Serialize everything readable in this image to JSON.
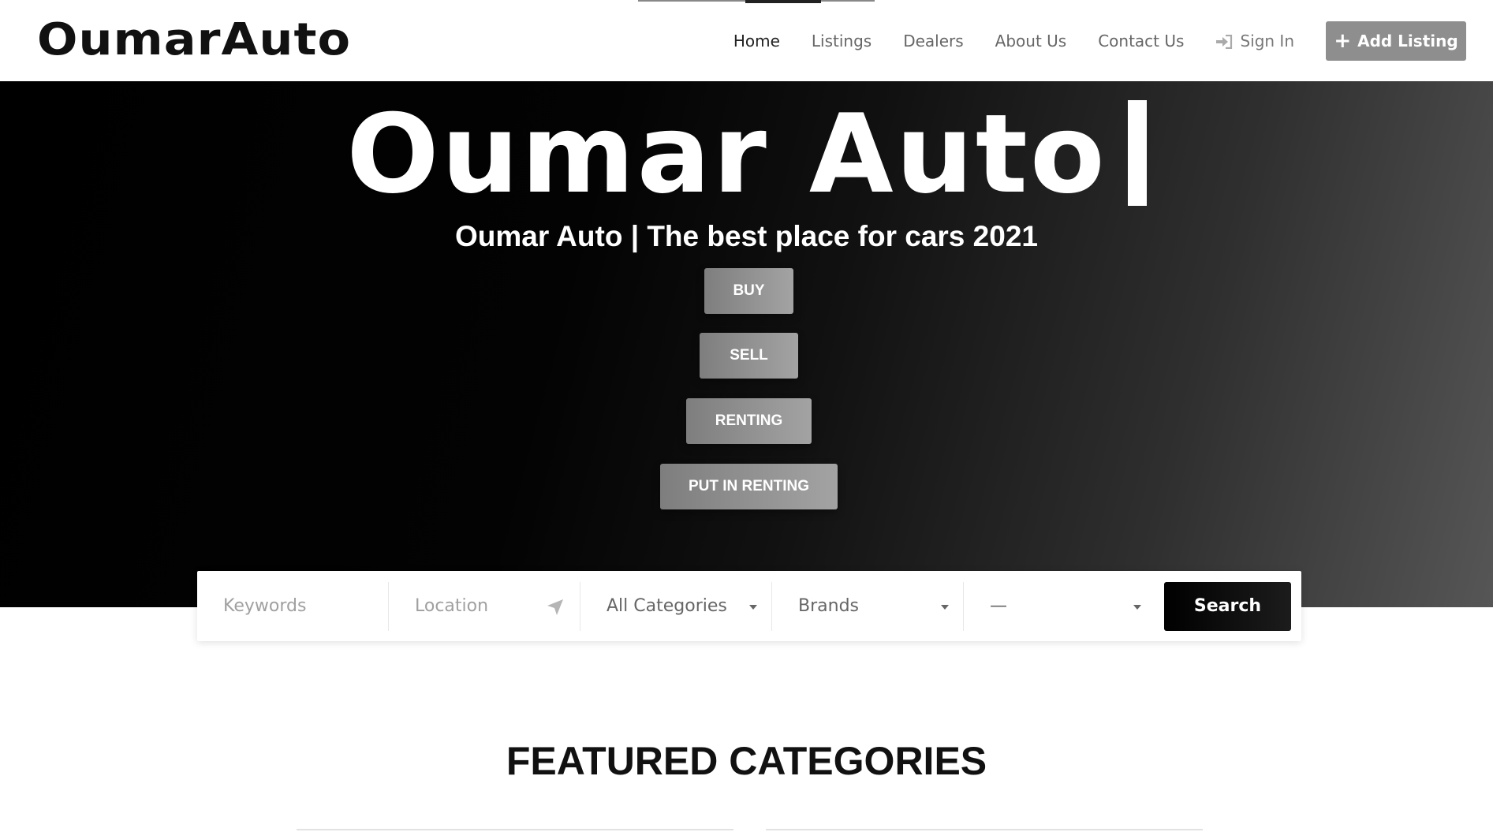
{
  "brand": {
    "logo_text": "OumarAuto"
  },
  "nav": {
    "items": [
      {
        "label": "Home",
        "active": true
      },
      {
        "label": "Listings",
        "active": false
      },
      {
        "label": "Dealers",
        "active": false
      },
      {
        "label": "About Us",
        "active": false
      },
      {
        "label": "Contact Us",
        "active": false
      }
    ],
    "signin_label": "Sign In",
    "add_listing_label": "Add Listing"
  },
  "hero": {
    "title": "Oumar Auto",
    "subtitle": "Oumar Auto | The best place for cars 2021",
    "buttons": [
      "BUY",
      "SELL",
      "RENTING",
      "PUT IN RENTING"
    ]
  },
  "search": {
    "keywords_placeholder": "Keywords",
    "location_placeholder": "Location",
    "category_value": "All Categories",
    "brand_value": "Brands",
    "extra_value": "—",
    "button_label": "Search"
  },
  "featured": {
    "title": "FEATURED CATEGORIES"
  },
  "colors": {
    "accent_button": "#8e8e8e",
    "search_button": "#000000",
    "hero_dark": "#000000",
    "hero_light": "#565656"
  }
}
